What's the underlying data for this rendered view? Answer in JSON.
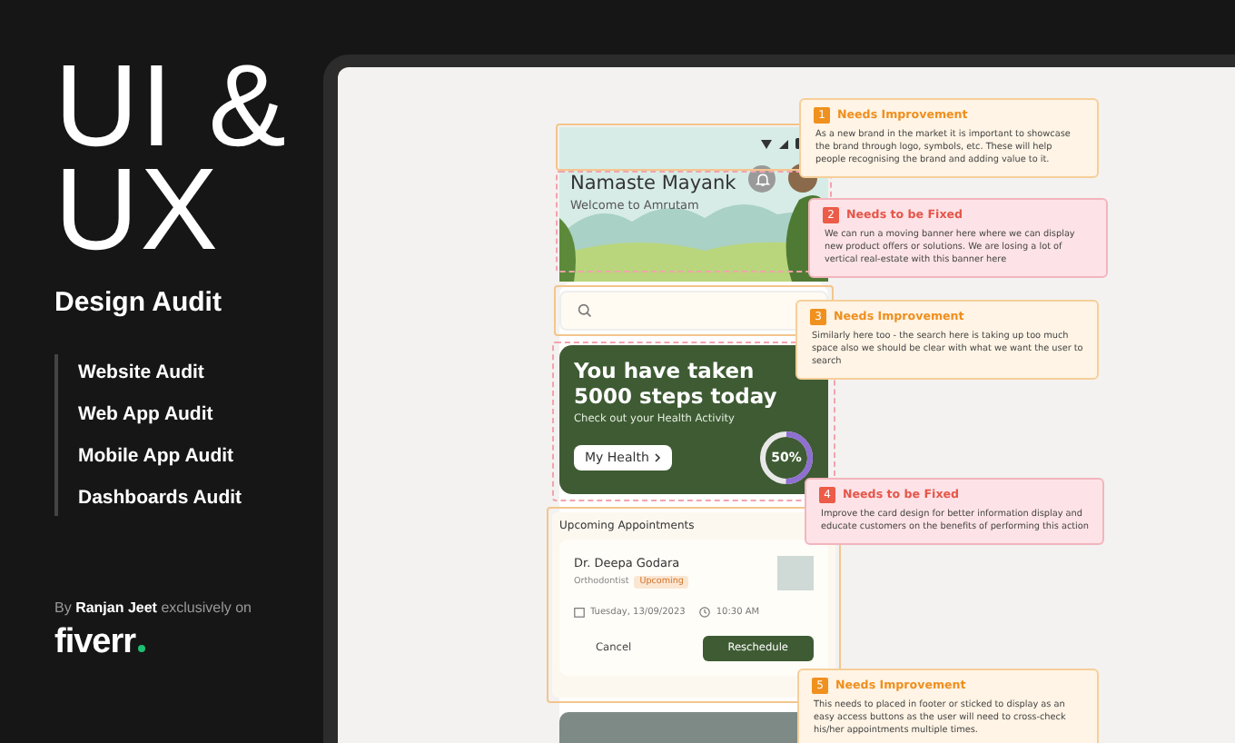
{
  "promo": {
    "title_lines": [
      "UI &",
      "UX"
    ],
    "subtitle": "Design Audit",
    "services": [
      "Website Audit",
      "Web App Audit",
      "Mobile App Audit",
      "Dashboards Audit"
    ],
    "credit": "By **Ranjan Jeet** exclusively on",
    "brand": "fiverr"
  },
  "app": {
    "header": {
      "greeting": "Namaste Mayank",
      "welcome": "Welcome to Amrutam"
    },
    "highlights": [
      {
        "kind": "improvement"
      },
      {
        "kind": "fix"
      },
      {
        "kind": "improvement"
      },
      {
        "kind": "fix"
      },
      {
        "kind": "improvement"
      }
    ],
    "steps_card": {
      "title_lines": [
        "You have taken",
        "5000 steps today"
      ],
      "subtitle": "Check out your Health Activity",
      "button": "My Health",
      "level": 0.5,
      "reading": "50%"
    },
    "appointments": {
      "heading": "Upcoming Appointments",
      "doctor": "Dr. Deepa Godara",
      "specialty": "Orthodontist",
      "status": "Upcoming",
      "date": "Tuesday, 13/09/2023",
      "time": "10:30 AM",
      "cancel": "Cancel",
      "reschedule": "Reschedule"
    }
  },
  "notes": [
    {
      "number": "1",
      "kind": "improvement",
      "title": "Needs Improvement",
      "text": "As a new brand in the market it is important to showcase the brand through logo, symbols, etc. These will help people recognising the brand and adding value to it."
    },
    {
      "number": "2",
      "kind": "fix",
      "title": "Needs to be Fixed",
      "text": "We can run a moving banner here where we can display new product offers or solutions. We are losing a lot of vertical real-estate with this banner here"
    },
    {
      "number": "3",
      "kind": "improvement",
      "title": "Needs Improvement",
      "text": "Similarly here too - the search here is taking up too much space also we should be clear with what we want the user to search"
    },
    {
      "number": "4",
      "kind": "fix",
      "title": "Needs to be Fixed",
      "text": "Improve the card design for better information display and educate customers on the benefits of performing this action"
    },
    {
      "number": "5",
      "kind": "improvement",
      "title": "Needs Improvement",
      "text": "This needs to placed in footer or sticked to display as an easy access buttons as the user will need to cross-check his/her appointments multiple times."
    }
  ]
}
